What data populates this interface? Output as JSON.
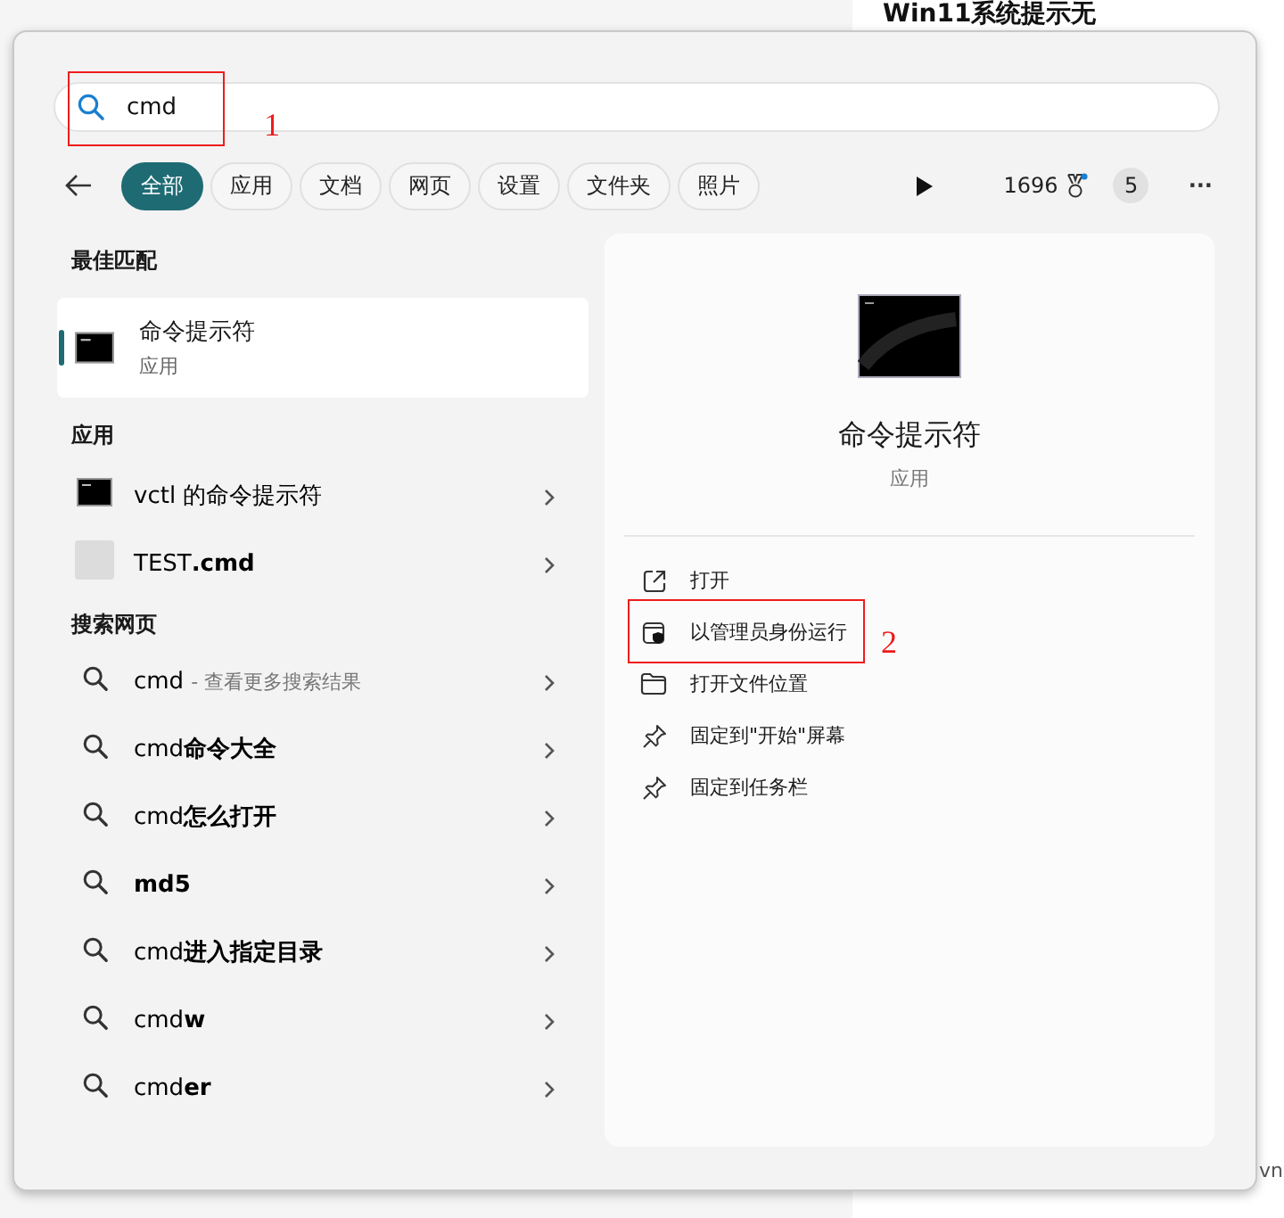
{
  "background_page": {
    "heading": "Win11系统提示无",
    "fragment_bottom": "vn"
  },
  "search": {
    "value": "cmd"
  },
  "filters": [
    {
      "label": "全部",
      "selected": true
    },
    {
      "label": "应用",
      "selected": false
    },
    {
      "label": "文档",
      "selected": false
    },
    {
      "label": "网页",
      "selected": false
    },
    {
      "label": "设置",
      "selected": false
    },
    {
      "label": "文件夹",
      "selected": false
    },
    {
      "label": "照片",
      "selected": false
    }
  ],
  "toolbar": {
    "points": "1696",
    "badge": "5",
    "more": "···"
  },
  "best_match": {
    "heading": "最佳匹配",
    "items": [
      {
        "title": "命令提示符",
        "subtitle": "应用",
        "selected": true
      }
    ]
  },
  "apps": {
    "heading": "应用",
    "items": [
      {
        "label": "vctl 的命令提示符",
        "kind": "cmd"
      },
      {
        "label": "TEST**.cmd**",
        "kind": "file"
      }
    ]
  },
  "web": {
    "heading": "搜索网页",
    "items": [
      {
        "label": "cmd",
        "hint": "- 查看更多搜索结果"
      },
      {
        "label": "cmd**命令大全**"
      },
      {
        "label": "cmd**怎么打开**"
      },
      {
        "label": "**md5**"
      },
      {
        "label": "cmd**进入指定目录**"
      },
      {
        "label": "cmd**w**"
      },
      {
        "label": "cmd**er**"
      }
    ]
  },
  "detail": {
    "title": "命令提示符",
    "subtitle": "应用",
    "actions": [
      {
        "label": "打开",
        "kind": "open"
      },
      {
        "label": "以管理员身份运行",
        "kind": "admin"
      },
      {
        "label": "打开文件位置",
        "kind": "folder"
      },
      {
        "label": "固定到\"开始\"屏幕",
        "kind": "pin"
      },
      {
        "label": "固定到任务栏",
        "kind": "pin"
      }
    ]
  },
  "annotations": [
    {
      "number": "1"
    },
    {
      "number": "2"
    }
  ]
}
